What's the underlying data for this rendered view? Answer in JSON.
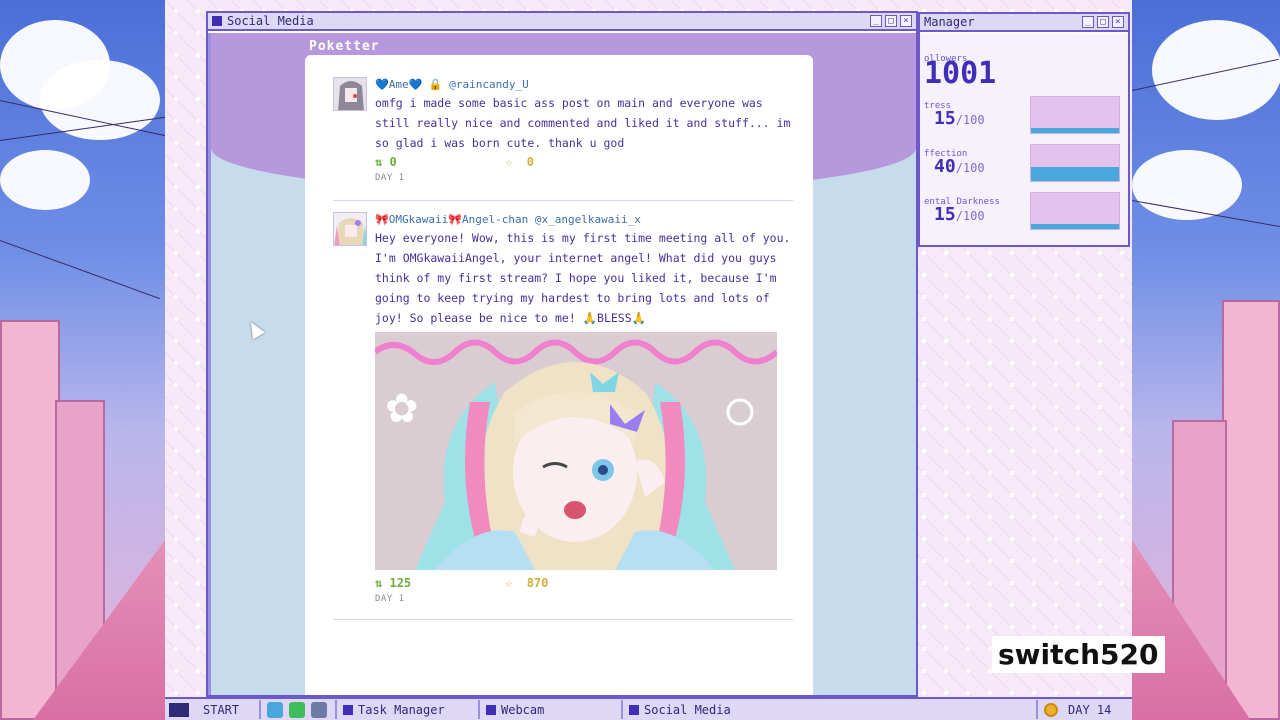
{
  "social_window": {
    "title": "Social Media",
    "app_name": "Poketter",
    "posts": [
      {
        "name": "💙Ame💙 🔒",
        "handle": "@raincandy_U",
        "text": "omfg i made some basic ass post on main and everyone was still really nice and commented and liked it and stuff... im so glad i was born cute. thank u god",
        "retweets": "0",
        "favorites": "0",
        "day": "DAY 1"
      },
      {
        "name": "🎀OMGkawaii🎀Angel-chan",
        "handle": "@x_angelkawaii_x",
        "text": "Hey everyone! Wow, this is my first time meeting all of you. I'm OMGkawaiiAngel, your internet angel! What did you guys think of my first stream? I hope you liked it, because I'm going to keep trying my hardest to bring lots and lots of joy! So please be nice to me! 🙏BLESS🙏",
        "retweets": "125",
        "favorites": "870",
        "day": "DAY 1"
      }
    ]
  },
  "manager_window": {
    "title": "Manager",
    "followers_label": "ollowers",
    "followers": "1001",
    "stats": [
      {
        "label": "tress",
        "value": "15",
        "max": "100",
        "level": 0.15
      },
      {
        "label": "ffection",
        "value": "40",
        "max": "100",
        "level": 0.4
      },
      {
        "label": "ental Darkness",
        "value": "15",
        "max": "100",
        "level": 0.15
      }
    ]
  },
  "taskbar": {
    "start_label": "START",
    "tasks": [
      "Task Manager",
      "Webcam",
      "Social Media"
    ],
    "day_label": "DAY 14"
  },
  "icons": {
    "retweet": "⇅",
    "favorite": "☆",
    "quick_launch": [
      "twitter-icon",
      "chat-icon",
      "computer-icon"
    ]
  },
  "watermark": "switch520",
  "colors": {
    "accent": "#3f2fb6",
    "bar_fill": "#4aa7dd",
    "retweet": "#6fae3a",
    "favorite": "#d4b03a"
  }
}
